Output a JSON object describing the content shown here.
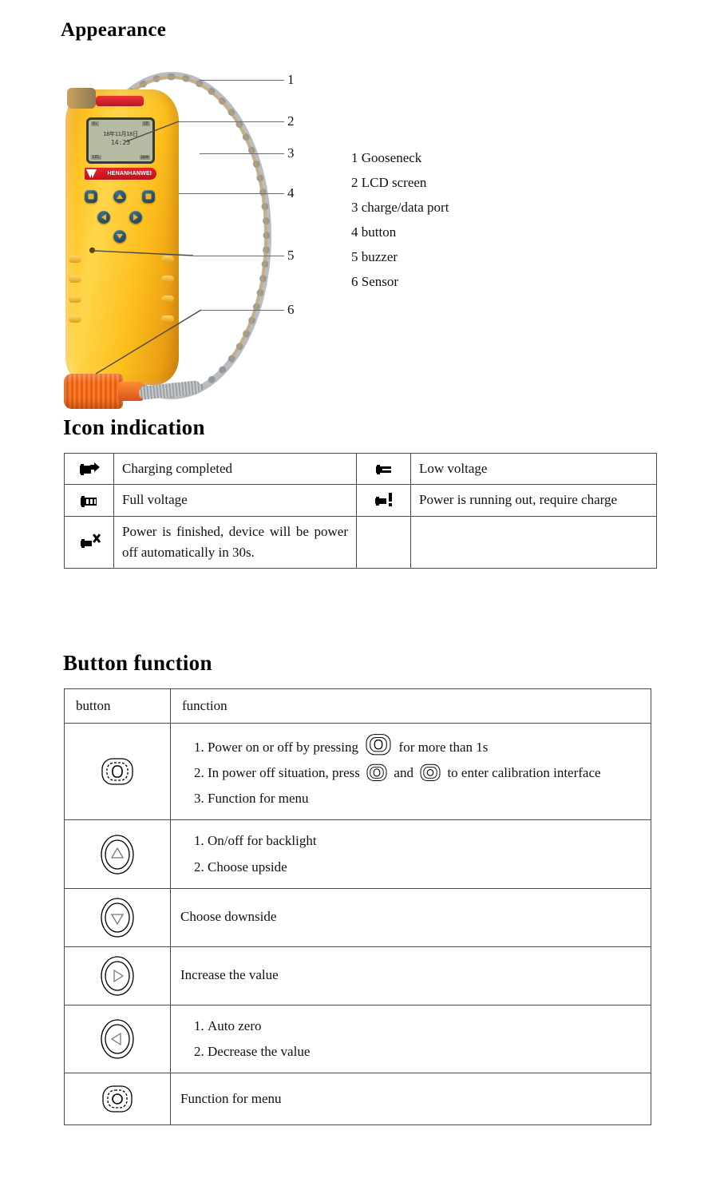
{
  "sections": {
    "appearance": {
      "heading": "Appearance",
      "callouts": [
        "1",
        "2",
        "3",
        "4",
        "5",
        "6"
      ],
      "legend": [
        "1 Gooseneck",
        "2 LCD screen",
        "3 charge/data port",
        "4 button",
        "5 buzzer",
        "6 Sensor"
      ],
      "device": {
        "lcd": {
          "date": "18年11月18日",
          "time": "14:23",
          "top_left": "O₂",
          "top_right": "CE",
          "bottom_left": "LEL",
          "bottom_right": "ppm"
        },
        "brand": "HENANHANWEI",
        "body_color": "#ffc324",
        "cap_color": "#ff7a22",
        "led_color": "#e8222e",
        "key_color": "#1b3c52"
      }
    },
    "icon_indication": {
      "heading": "Icon indication",
      "rows": [
        {
          "left_icon": "battery-charging-complete-icon",
          "left_text": "Charging completed",
          "right_icon": "battery-low-icon",
          "right_text": "Low voltage"
        },
        {
          "left_icon": "battery-full-icon",
          "left_text": "Full voltage",
          "right_icon": "battery-warning-icon",
          "right_text": "Power is running out, require charge"
        },
        {
          "left_icon": "battery-empty-x-icon",
          "left_text": "Power is finished, device will be power off automatically in 30s.",
          "right_icon": "",
          "right_text": ""
        }
      ]
    },
    "button_function": {
      "heading": "Button function",
      "headers": {
        "button": "button",
        "function": "function"
      },
      "rows": [
        {
          "icon": "power-button-icon",
          "items": [
            {
              "parts": [
                {
                  "type": "text",
                  "value": "Power on or off by pressing "
                },
                {
                  "type": "icon",
                  "value": "power-button-icon"
                },
                {
                  "type": "text",
                  "value": " for more than 1s"
                }
              ]
            },
            {
              "parts": [
                {
                  "type": "text",
                  "value": "In power off situation, press "
                },
                {
                  "type": "icon",
                  "value": "power-button-icon"
                },
                {
                  "type": "text",
                  "value": " and "
                },
                {
                  "type": "icon",
                  "value": "menu-button-icon"
                },
                {
                  "type": "text",
                  "value": " to enter calibration interface"
                }
              ]
            },
            {
              "parts": [
                {
                  "type": "text",
                  "value": "Function for menu"
                }
              ]
            }
          ]
        },
        {
          "icon": "up-button-icon",
          "items": [
            {
              "parts": [
                {
                  "type": "text",
                  "value": "On/off for backlight"
                }
              ]
            },
            {
              "parts": [
                {
                  "type": "text",
                  "value": "Choose upside"
                }
              ]
            }
          ]
        },
        {
          "icon": "down-button-icon",
          "plain": "Choose downside"
        },
        {
          "icon": "right-button-icon",
          "plain": "Increase the value"
        },
        {
          "icon": "left-button-icon",
          "items": [
            {
              "parts": [
                {
                  "type": "text",
                  "value": "Auto zero"
                }
              ]
            },
            {
              "parts": [
                {
                  "type": "text",
                  "value": "Decrease the value"
                }
              ]
            }
          ]
        },
        {
          "icon": "menu-button-icon",
          "plain": "Function for menu"
        }
      ]
    }
  },
  "colors": {
    "table_border": "#4a4a4a",
    "leader_line": "#6d6d6d",
    "text": "#111111",
    "background": "#ffffff"
  }
}
